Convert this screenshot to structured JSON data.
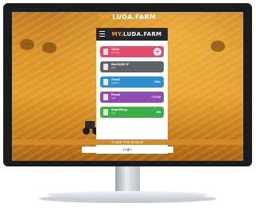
{
  "app": {
    "logo_prefix": "MY.",
    "logo_main": "LUDA.FARM",
    "brand_accent": "#f2a33a"
  },
  "phone": {
    "logo_prefix": "MY.",
    "logo_main": "LUDA.FARM",
    "menu_icon": "hamburger-icon",
    "cards": [
      {
        "name": "Table",
        "sub": "Pneumy",
        "value": "",
        "color": "#e24c6c",
        "icon": "table-icon",
        "action": "+"
      },
      {
        "name": "NeoVIAM IP",
        "sub": "Test",
        "value": "",
        "color": "#5f6168",
        "icon": "server-icon",
        "action": ""
      },
      {
        "name": "Cloud",
        "sub": "System",
        "value": "99%",
        "color": "#2f8fd0",
        "icon": "cloud-icon",
        "action": ""
      },
      {
        "name": "Fence",
        "sub": "Test",
        "value": "7.5 kV",
        "color": "#8f4bb3",
        "icon": "fence-icon",
        "action": ""
      },
      {
        "name": "SmartPlug",
        "sub": "Test",
        "value": "ON",
        "color": "#3dae49",
        "icon": "plug-icon",
        "action": ""
      }
    ]
  },
  "actions": {
    "create_label": "Create Free Account",
    "login_label": "Login"
  }
}
